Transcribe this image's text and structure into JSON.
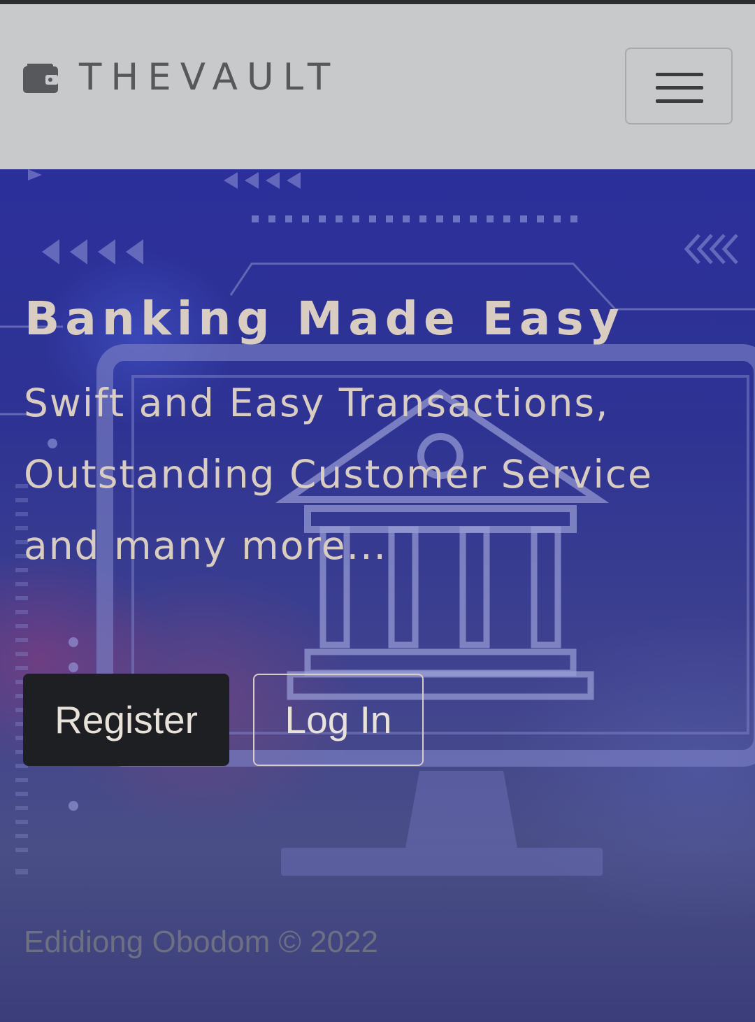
{
  "navbar": {
    "brand_name": "THEVAULT",
    "brand_icon": "wallet-icon",
    "menu_icon": "hamburger-menu-icon"
  },
  "hero": {
    "title": "Banking Made Easy",
    "lead": "Swift and Easy Transactions, Outstanding Customer Service and many more...",
    "register_label": "Register",
    "login_label": "Log In",
    "background_image": "bank-building-on-monitor-illustration"
  },
  "footer": {
    "text": "Edidiong Obodom © 2022"
  },
  "colors": {
    "navbar_bg": "#c8c9cb",
    "brand_text": "#56585b",
    "hero_text": "#d9cdc2",
    "register_bg": "#1d1f22",
    "footer_text": "#6d6f83",
    "hero_bg": "#2e3393"
  }
}
